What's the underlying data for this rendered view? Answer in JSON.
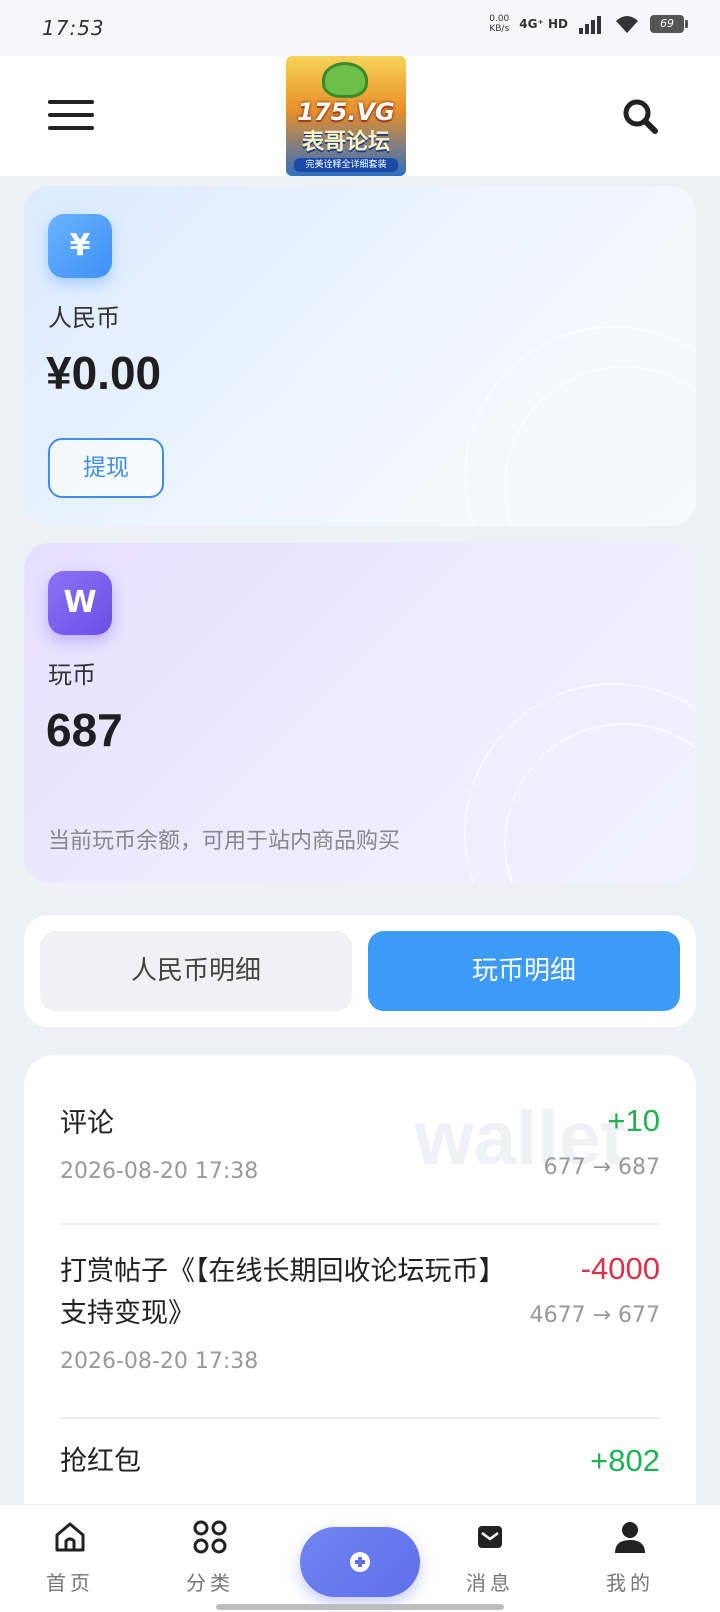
{
  "status_bar": {
    "time": "17:53",
    "net_speed_value": "0.00",
    "net_speed_unit": "KB/s",
    "network": "4G⁺ HD",
    "battery": "69"
  },
  "header": {
    "logo_site": "175.VG",
    "logo_name": "表哥论坛",
    "logo_tagline": "完美诠释全详细套装"
  },
  "rmb_card": {
    "icon_symbol": "¥",
    "label": "人民币",
    "amount": "¥0.00",
    "withdraw_label": "提现"
  },
  "coin_card": {
    "icon_symbol": "W",
    "label": "玩币",
    "amount": "687",
    "description": "当前玩币余额，可用于站内商品购买"
  },
  "tabs": [
    {
      "label": "人民币明细",
      "active": false
    },
    {
      "label": "玩币明细",
      "active": true
    }
  ],
  "watermark": "wallet",
  "records": [
    {
      "title": "评论",
      "time": "2026-08-20 17:38",
      "delta": "+10",
      "balance": "677 → 687"
    },
    {
      "title": "打赏帖子《【在线长期回收论坛玩币】支持变现》",
      "time": "2026-08-20 17:38",
      "delta": "-4000",
      "balance": "4677 → 677"
    },
    {
      "title": "抢红包",
      "time": "",
      "delta": "+802",
      "balance": ""
    }
  ],
  "bottom_nav": [
    {
      "label": "首页",
      "icon": "home-icon"
    },
    {
      "label": "分类",
      "icon": "grid-icon"
    },
    {
      "label": "",
      "icon": "plus-circle-icon"
    },
    {
      "label": "消息",
      "icon": "mail-icon"
    },
    {
      "label": "我的",
      "icon": "user-icon"
    }
  ],
  "colors": {
    "accent_blue": "#3d9bf6",
    "positive": "#1db354",
    "negative": "#d83248",
    "coin_purple": "#6a4ee6"
  }
}
